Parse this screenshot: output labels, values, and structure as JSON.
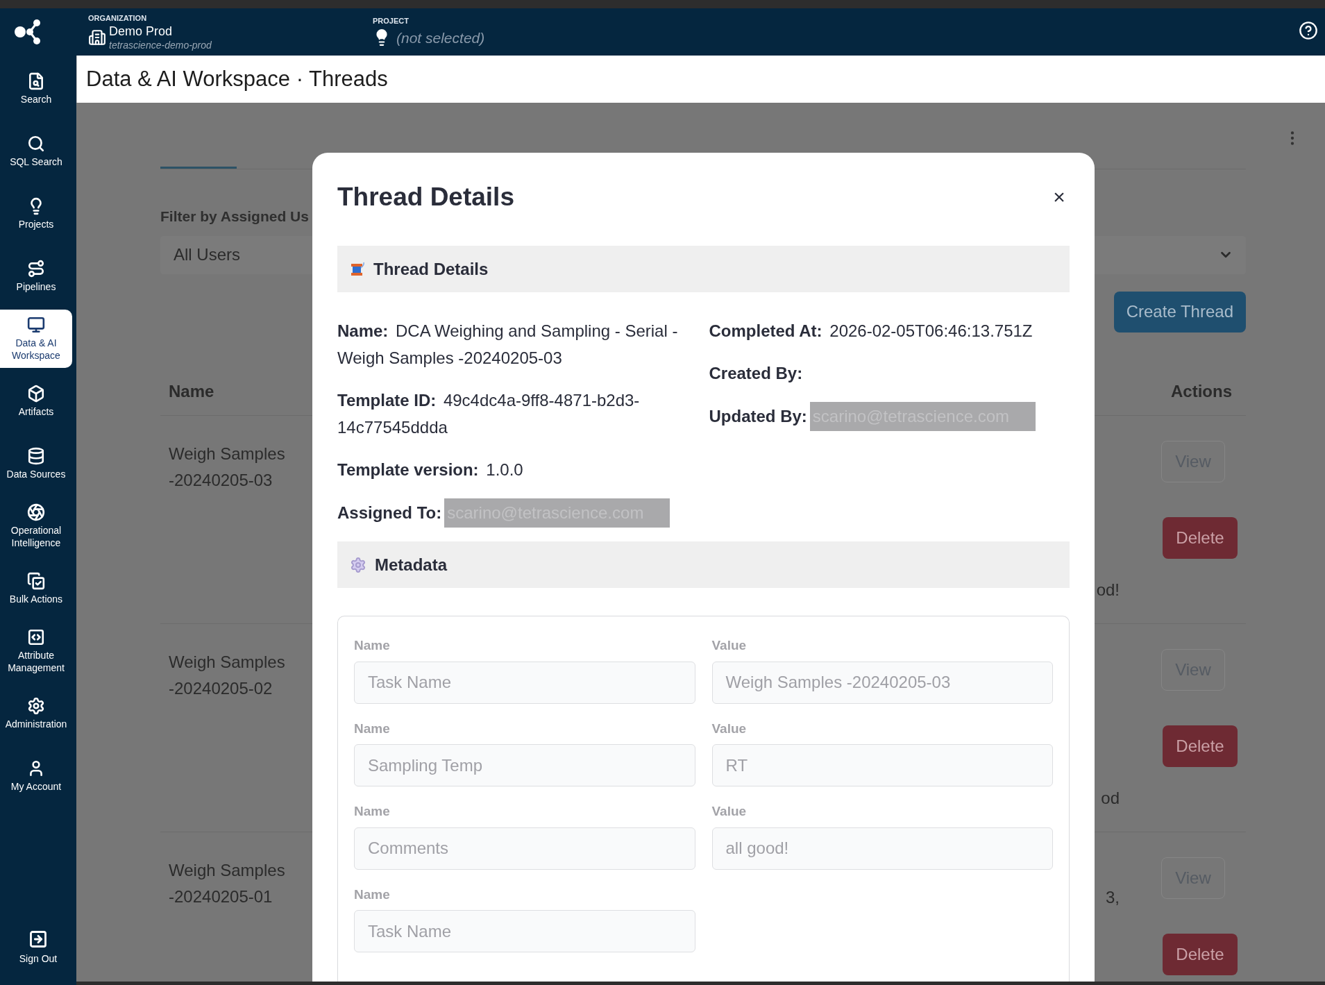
{
  "header": {
    "org_label": "ORGANIZATION",
    "org_name": "Demo Prod",
    "org_slug": "tetrascience-demo-prod",
    "project_label": "PROJECT",
    "project_value": "(not selected)"
  },
  "sidebar": {
    "items": [
      {
        "label": "Search",
        "selected": false
      },
      {
        "label": "SQL Search",
        "selected": false
      },
      {
        "label": "Projects",
        "selected": false
      },
      {
        "label": "Pipelines",
        "selected": false
      },
      {
        "label": "Data & AI Workspace",
        "selected": true
      },
      {
        "label": "Artifacts",
        "selected": false
      },
      {
        "label": "Data Sources",
        "selected": false
      },
      {
        "label": "Operational Intelligence",
        "selected": false
      },
      {
        "label": "Bulk Actions",
        "selected": false
      },
      {
        "label": "Attribute Management",
        "selected": false
      },
      {
        "label": "Administration",
        "selected": false
      },
      {
        "label": "My Account",
        "selected": false
      }
    ],
    "footer_item": {
      "label": "Sign Out"
    }
  },
  "page_title": "Data & AI Workspace · Threads",
  "background": {
    "filter_label": "Filter by Assigned Us",
    "filter_value": "All Users",
    "create_button": "Create Thread",
    "columns": [
      "Name",
      "Actions"
    ],
    "rows": [
      {
        "name": "Weigh Samples -20240205-03",
        "column_3": "od!",
        "view": "View",
        "delete": "Delete"
      },
      {
        "name": "Weigh Samples -20240205-02",
        "column_3": "od",
        "view": "View",
        "delete": "Delete"
      },
      {
        "name": "Weigh Samples -20240205-01",
        "column_3": "3,",
        "view": "View",
        "delete": "Delete"
      }
    ]
  },
  "modal": {
    "title": "Thread Details",
    "close": "×",
    "details_heading": "Thread Details",
    "details_left": [
      {
        "label": "Name:",
        "value": "DCA Weighing and Sampling - Serial - Weigh Samples -20240205-03",
        "kind": "text"
      },
      {
        "label": "Template ID:",
        "value": "49c4dc4a-9ff8-4871-b2d3-14c77545ddda",
        "kind": "text"
      },
      {
        "label": "Template version:",
        "value": "1.0.0",
        "kind": "text"
      },
      {
        "label": "Assigned To:",
        "value": "scarino@tetrascience.com",
        "kind": "redacted"
      }
    ],
    "details_right": [
      {
        "label": "Completed At:",
        "value": "2026-02-05T06:46:13.751Z",
        "kind": "text"
      },
      {
        "label": "Created By:",
        "kind": "text"
      },
      {
        "label": "Updated By:",
        "value": "scarino@tetrascience.com",
        "kind": "redacted"
      }
    ],
    "metadata_heading": "Metadata",
    "metadata": [
      {
        "name_label": "Name",
        "name": "Task Name",
        "value_label": "Value",
        "value": "Weigh Samples -20240205-03",
        "disabled": true
      },
      {
        "name_label": "Name",
        "name": "Sampling Temp",
        "value_label": "Value",
        "value": "RT",
        "disabled": true
      },
      {
        "name_label": "Name",
        "name": "Comments",
        "value_label": "Value",
        "value": "all good!",
        "disabled": true
      },
      {
        "name_label": "Name",
        "name": "Task Name",
        "disabled": true
      }
    ]
  }
}
